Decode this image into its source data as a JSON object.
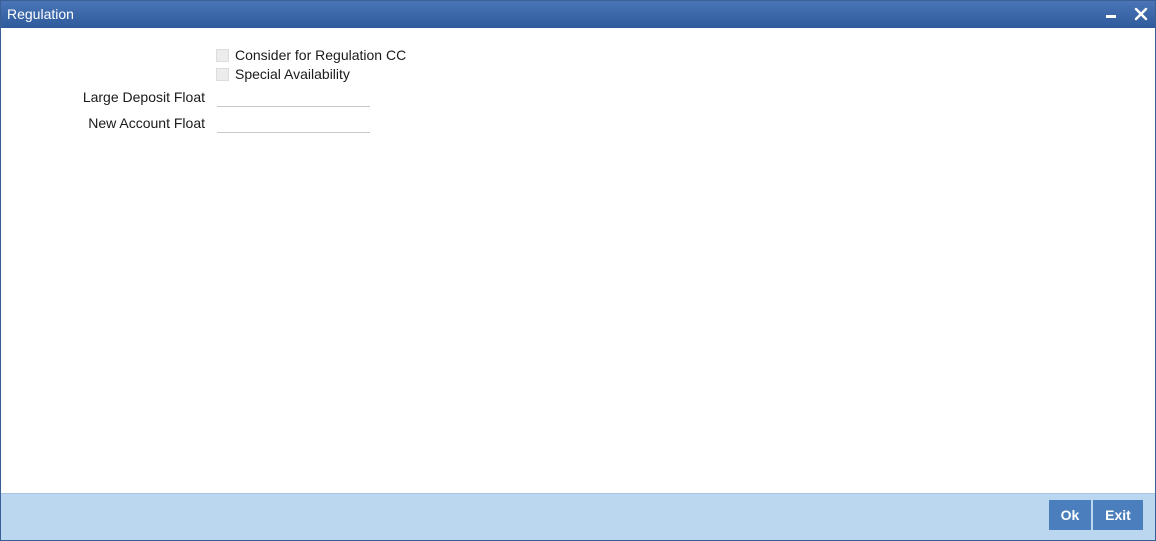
{
  "window": {
    "title": "Regulation",
    "controls": {
      "minimize_icon": "minimize-icon",
      "close_icon": "close-icon"
    }
  },
  "form": {
    "checkboxes": [
      {
        "label": "Consider for Regulation CC",
        "checked": false
      },
      {
        "label": "Special Availability",
        "checked": false
      }
    ],
    "fields": [
      {
        "label": "Large Deposit Float",
        "value": ""
      },
      {
        "label": "New Account Float",
        "value": ""
      }
    ]
  },
  "footer": {
    "ok_label": "Ok",
    "exit_label": "Exit"
  },
  "colors": {
    "titlebar": "#2f5a9c",
    "footer": "#bad7ef",
    "button": "#4a7ebd"
  }
}
